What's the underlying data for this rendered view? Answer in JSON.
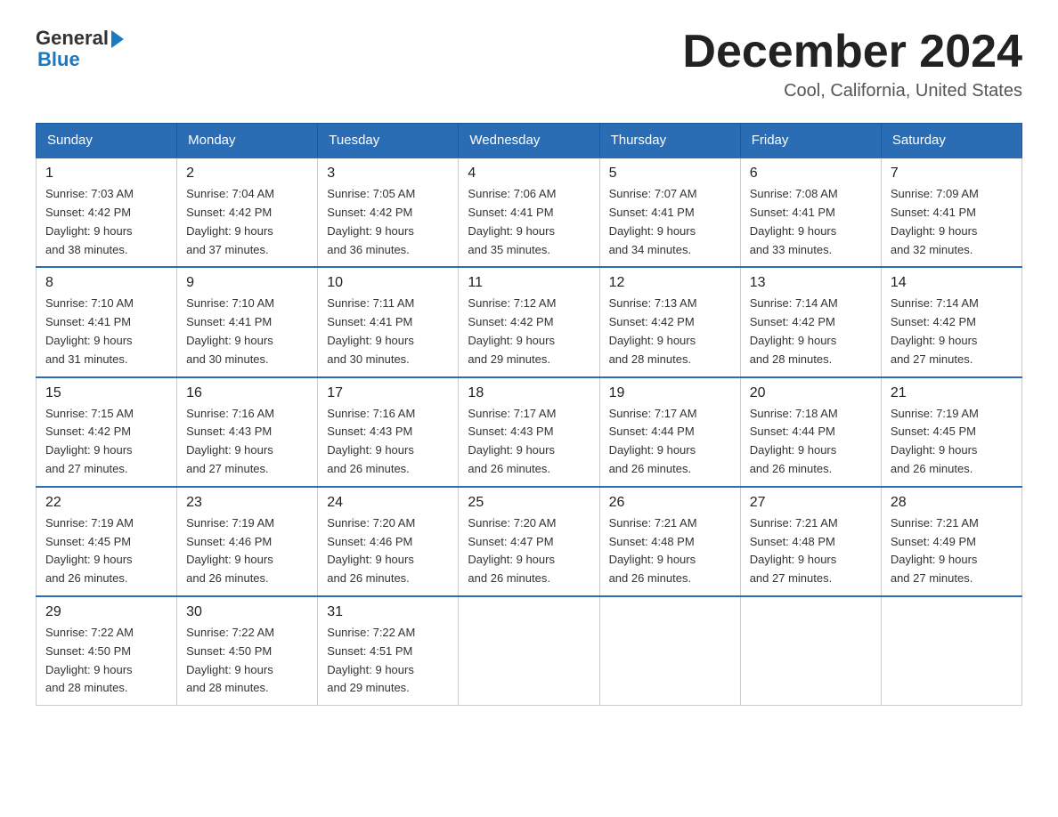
{
  "header": {
    "logo": {
      "general": "General",
      "blue": "Blue"
    },
    "title": "December 2024",
    "location": "Cool, California, United States"
  },
  "weekdays": [
    "Sunday",
    "Monday",
    "Tuesday",
    "Wednesday",
    "Thursday",
    "Friday",
    "Saturday"
  ],
  "weeks": [
    [
      {
        "day": "1",
        "sunrise": "Sunrise: 7:03 AM",
        "sunset": "Sunset: 4:42 PM",
        "daylight": "Daylight: 9 hours",
        "daylight2": "and 38 minutes."
      },
      {
        "day": "2",
        "sunrise": "Sunrise: 7:04 AM",
        "sunset": "Sunset: 4:42 PM",
        "daylight": "Daylight: 9 hours",
        "daylight2": "and 37 minutes."
      },
      {
        "day": "3",
        "sunrise": "Sunrise: 7:05 AM",
        "sunset": "Sunset: 4:42 PM",
        "daylight": "Daylight: 9 hours",
        "daylight2": "and 36 minutes."
      },
      {
        "day": "4",
        "sunrise": "Sunrise: 7:06 AM",
        "sunset": "Sunset: 4:41 PM",
        "daylight": "Daylight: 9 hours",
        "daylight2": "and 35 minutes."
      },
      {
        "day": "5",
        "sunrise": "Sunrise: 7:07 AM",
        "sunset": "Sunset: 4:41 PM",
        "daylight": "Daylight: 9 hours",
        "daylight2": "and 34 minutes."
      },
      {
        "day": "6",
        "sunrise": "Sunrise: 7:08 AM",
        "sunset": "Sunset: 4:41 PM",
        "daylight": "Daylight: 9 hours",
        "daylight2": "and 33 minutes."
      },
      {
        "day": "7",
        "sunrise": "Sunrise: 7:09 AM",
        "sunset": "Sunset: 4:41 PM",
        "daylight": "Daylight: 9 hours",
        "daylight2": "and 32 minutes."
      }
    ],
    [
      {
        "day": "8",
        "sunrise": "Sunrise: 7:10 AM",
        "sunset": "Sunset: 4:41 PM",
        "daylight": "Daylight: 9 hours",
        "daylight2": "and 31 minutes."
      },
      {
        "day": "9",
        "sunrise": "Sunrise: 7:10 AM",
        "sunset": "Sunset: 4:41 PM",
        "daylight": "Daylight: 9 hours",
        "daylight2": "and 30 minutes."
      },
      {
        "day": "10",
        "sunrise": "Sunrise: 7:11 AM",
        "sunset": "Sunset: 4:41 PM",
        "daylight": "Daylight: 9 hours",
        "daylight2": "and 30 minutes."
      },
      {
        "day": "11",
        "sunrise": "Sunrise: 7:12 AM",
        "sunset": "Sunset: 4:42 PM",
        "daylight": "Daylight: 9 hours",
        "daylight2": "and 29 minutes."
      },
      {
        "day": "12",
        "sunrise": "Sunrise: 7:13 AM",
        "sunset": "Sunset: 4:42 PM",
        "daylight": "Daylight: 9 hours",
        "daylight2": "and 28 minutes."
      },
      {
        "day": "13",
        "sunrise": "Sunrise: 7:14 AM",
        "sunset": "Sunset: 4:42 PM",
        "daylight": "Daylight: 9 hours",
        "daylight2": "and 28 minutes."
      },
      {
        "day": "14",
        "sunrise": "Sunrise: 7:14 AM",
        "sunset": "Sunset: 4:42 PM",
        "daylight": "Daylight: 9 hours",
        "daylight2": "and 27 minutes."
      }
    ],
    [
      {
        "day": "15",
        "sunrise": "Sunrise: 7:15 AM",
        "sunset": "Sunset: 4:42 PM",
        "daylight": "Daylight: 9 hours",
        "daylight2": "and 27 minutes."
      },
      {
        "day": "16",
        "sunrise": "Sunrise: 7:16 AM",
        "sunset": "Sunset: 4:43 PM",
        "daylight": "Daylight: 9 hours",
        "daylight2": "and 27 minutes."
      },
      {
        "day": "17",
        "sunrise": "Sunrise: 7:16 AM",
        "sunset": "Sunset: 4:43 PM",
        "daylight": "Daylight: 9 hours",
        "daylight2": "and 26 minutes."
      },
      {
        "day": "18",
        "sunrise": "Sunrise: 7:17 AM",
        "sunset": "Sunset: 4:43 PM",
        "daylight": "Daylight: 9 hours",
        "daylight2": "and 26 minutes."
      },
      {
        "day": "19",
        "sunrise": "Sunrise: 7:17 AM",
        "sunset": "Sunset: 4:44 PM",
        "daylight": "Daylight: 9 hours",
        "daylight2": "and 26 minutes."
      },
      {
        "day": "20",
        "sunrise": "Sunrise: 7:18 AM",
        "sunset": "Sunset: 4:44 PM",
        "daylight": "Daylight: 9 hours",
        "daylight2": "and 26 minutes."
      },
      {
        "day": "21",
        "sunrise": "Sunrise: 7:19 AM",
        "sunset": "Sunset: 4:45 PM",
        "daylight": "Daylight: 9 hours",
        "daylight2": "and 26 minutes."
      }
    ],
    [
      {
        "day": "22",
        "sunrise": "Sunrise: 7:19 AM",
        "sunset": "Sunset: 4:45 PM",
        "daylight": "Daylight: 9 hours",
        "daylight2": "and 26 minutes."
      },
      {
        "day": "23",
        "sunrise": "Sunrise: 7:19 AM",
        "sunset": "Sunset: 4:46 PM",
        "daylight": "Daylight: 9 hours",
        "daylight2": "and 26 minutes."
      },
      {
        "day": "24",
        "sunrise": "Sunrise: 7:20 AM",
        "sunset": "Sunset: 4:46 PM",
        "daylight": "Daylight: 9 hours",
        "daylight2": "and 26 minutes."
      },
      {
        "day": "25",
        "sunrise": "Sunrise: 7:20 AM",
        "sunset": "Sunset: 4:47 PM",
        "daylight": "Daylight: 9 hours",
        "daylight2": "and 26 minutes."
      },
      {
        "day": "26",
        "sunrise": "Sunrise: 7:21 AM",
        "sunset": "Sunset: 4:48 PM",
        "daylight": "Daylight: 9 hours",
        "daylight2": "and 26 minutes."
      },
      {
        "day": "27",
        "sunrise": "Sunrise: 7:21 AM",
        "sunset": "Sunset: 4:48 PM",
        "daylight": "Daylight: 9 hours",
        "daylight2": "and 27 minutes."
      },
      {
        "day": "28",
        "sunrise": "Sunrise: 7:21 AM",
        "sunset": "Sunset: 4:49 PM",
        "daylight": "Daylight: 9 hours",
        "daylight2": "and 27 minutes."
      }
    ],
    [
      {
        "day": "29",
        "sunrise": "Sunrise: 7:22 AM",
        "sunset": "Sunset: 4:50 PM",
        "daylight": "Daylight: 9 hours",
        "daylight2": "and 28 minutes."
      },
      {
        "day": "30",
        "sunrise": "Sunrise: 7:22 AM",
        "sunset": "Sunset: 4:50 PM",
        "daylight": "Daylight: 9 hours",
        "daylight2": "and 28 minutes."
      },
      {
        "day": "31",
        "sunrise": "Sunrise: 7:22 AM",
        "sunset": "Sunset: 4:51 PM",
        "daylight": "Daylight: 9 hours",
        "daylight2": "and 29 minutes."
      },
      {
        "day": "",
        "sunrise": "",
        "sunset": "",
        "daylight": "",
        "daylight2": ""
      },
      {
        "day": "",
        "sunrise": "",
        "sunset": "",
        "daylight": "",
        "daylight2": ""
      },
      {
        "day": "",
        "sunrise": "",
        "sunset": "",
        "daylight": "",
        "daylight2": ""
      },
      {
        "day": "",
        "sunrise": "",
        "sunset": "",
        "daylight": "",
        "daylight2": ""
      }
    ]
  ]
}
